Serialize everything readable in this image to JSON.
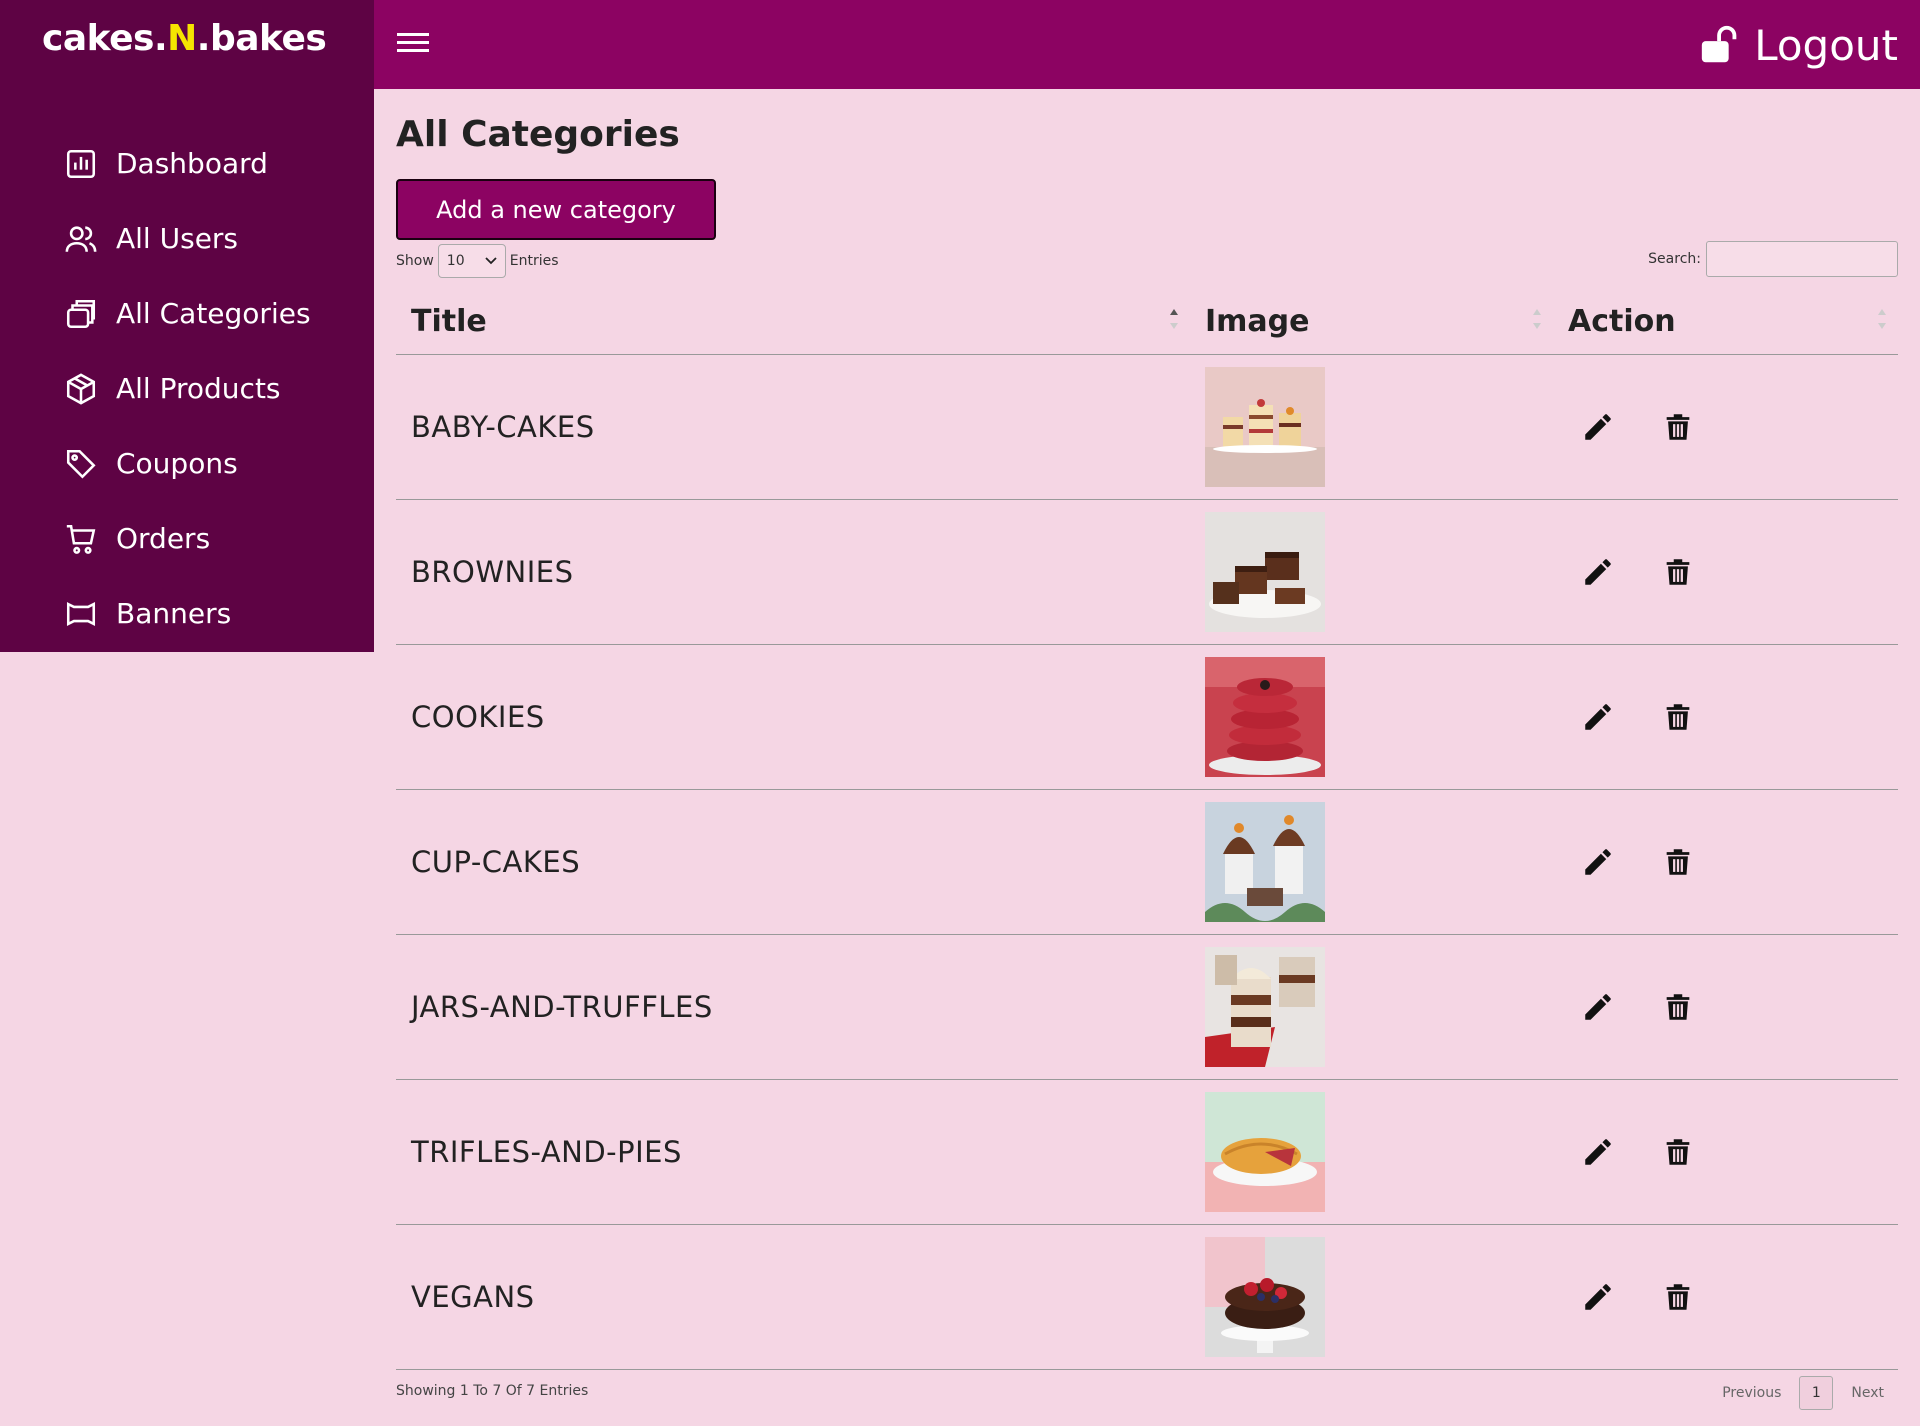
{
  "brand": {
    "part1": "cakes.",
    "accent": "N",
    "part2": ".bakes"
  },
  "colors": {
    "sidebar": "#5e0344",
    "topbar": "#8c0362",
    "background": "#f5d6e4",
    "accent": "#f5e400"
  },
  "sidebar": {
    "items": [
      {
        "label": "Dashboard",
        "icon": "chart-icon"
      },
      {
        "label": "All Users",
        "icon": "users-icon"
      },
      {
        "label": "All Categories",
        "icon": "categories-icon"
      },
      {
        "label": "All Products",
        "icon": "box-icon"
      },
      {
        "label": "Coupons",
        "icon": "tag-icon"
      },
      {
        "label": "Orders",
        "icon": "cart-icon"
      },
      {
        "label": "Banners",
        "icon": "banner-icon"
      }
    ]
  },
  "topbar": {
    "logout_label": "Logout"
  },
  "main": {
    "title": "All Categories",
    "add_button": "Add a new category",
    "show_label": "Show",
    "entries_value": "10",
    "entries_label": "Entries",
    "search_label": "Search:"
  },
  "table": {
    "headers": [
      "Title",
      "Image",
      "Action"
    ],
    "rows": [
      {
        "title": "BABY-CAKES"
      },
      {
        "title": "BROWNIES"
      },
      {
        "title": "COOKIES"
      },
      {
        "title": "CUP-CAKES"
      },
      {
        "title": "JARS-AND-TRUFFLES"
      },
      {
        "title": "TRIFLES-AND-PIES"
      },
      {
        "title": "VEGANS"
      }
    ]
  },
  "footer": {
    "info": "Showing 1 To 7 Of 7 Entries",
    "previous": "Previous",
    "page": "1",
    "next": "Next"
  }
}
